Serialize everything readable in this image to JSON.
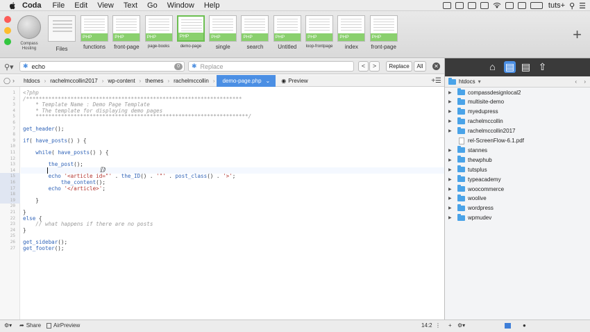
{
  "menubar": {
    "app": "Coda",
    "menus": [
      "File",
      "Edit",
      "View",
      "Text",
      "Go",
      "Window",
      "Help"
    ],
    "user": "tuts+"
  },
  "toolbar": {
    "site_label": "Compass Hosting",
    "files_label": "Files",
    "tabs": [
      {
        "label": "functions",
        "lang": "PHP"
      },
      {
        "label": "front-page",
        "lang": "PHP"
      },
      {
        "label": "page-books",
        "lang": "PHP"
      },
      {
        "label": "demo-page",
        "lang": "PHP"
      },
      {
        "label": "single",
        "lang": "PHP"
      },
      {
        "label": "search",
        "lang": "PHP"
      },
      {
        "label": "Untitled",
        "lang": "PHP"
      },
      {
        "label": "loop-frontpage",
        "lang": "PHP"
      },
      {
        "label": "index",
        "lang": "PHP"
      },
      {
        "label": "front-page",
        "lang": "PHP"
      }
    ],
    "add": "+"
  },
  "find": {
    "query": "echo",
    "count": "0",
    "replace_placeholder": "Replace",
    "replace_label": "Replace",
    "all_label": "All",
    "prev": "<",
    "next": ">"
  },
  "path": {
    "crumbs": [
      "htdocs",
      "rachelmccollin2017",
      "wp-content",
      "themes",
      "rachelmccollin"
    ],
    "file": "demo-page.php",
    "preview": "Preview"
  },
  "code": {
    "lines": [
      "<?php",
      "/********************************************************************",
      "    * Template Name : Demo Page Template",
      "    * The template for displaying demo pages",
      "    *******************************************************************/",
      "",
      "get_header();",
      "",
      "if( have_posts() ) {",
      "",
      "    while( have_posts() ) {",
      "",
      "        the_post();",
      "        ",
      "        echo '<article id=\"' . the_ID() . '\"' . post_class() . '>';",
      "            the_content();",
      "        echo '</article>';",
      "",
      "    }",
      "",
      "}",
      "else {",
      "    // what happens if there are no posts",
      "}",
      "",
      "get_sidebar();",
      "get_footer();"
    ]
  },
  "status": {
    "share": "Share",
    "airpreview": "AirPreview",
    "position": "14:2"
  },
  "files_panel": {
    "current": "htdocs",
    "items": [
      {
        "name": "compassdesignlocal2",
        "type": "folder"
      },
      {
        "name": "multisite-demo",
        "type": "folder"
      },
      {
        "name": "myedupress",
        "type": "folder"
      },
      {
        "name": "rachelmccollin",
        "type": "folder"
      },
      {
        "name": "rachelmccollin2017",
        "type": "folder"
      },
      {
        "name": "rel-ScreenFlow-6.1.pdf",
        "type": "file"
      },
      {
        "name": "stannes",
        "type": "folder"
      },
      {
        "name": "thewphub",
        "type": "folder"
      },
      {
        "name": "tutsplus",
        "type": "folder"
      },
      {
        "name": "typeacademy",
        "type": "folder"
      },
      {
        "name": "woocommerce",
        "type": "folder"
      },
      {
        "name": "woolive",
        "type": "folder"
      },
      {
        "name": "wordpress",
        "type": "folder"
      },
      {
        "name": "wpmudev",
        "type": "folder"
      }
    ]
  },
  "colors": {
    "accent": "#4b8fe4",
    "php_badge": "#8ad06e",
    "panel_top": "#3a3a3a"
  }
}
